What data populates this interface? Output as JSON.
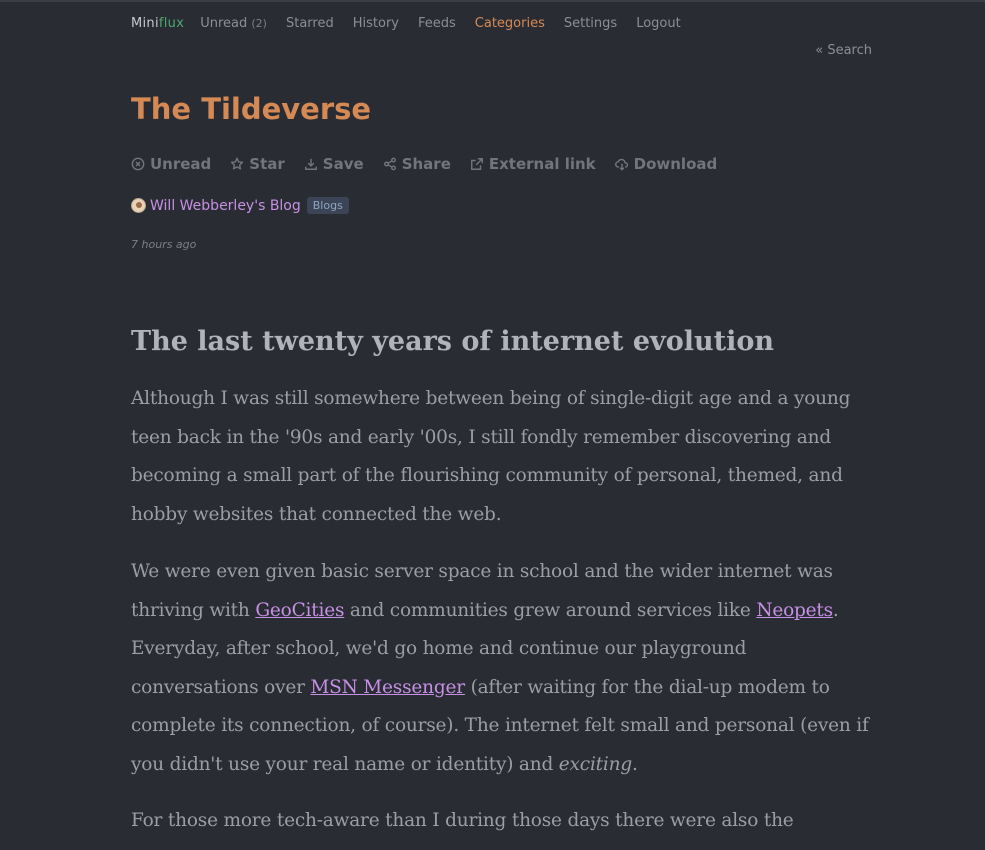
{
  "app": {
    "logo_mini": "Mini",
    "logo_flux": "flux"
  },
  "nav": {
    "unread": "Unread",
    "unread_count": "(2)",
    "starred": "Starred",
    "history": "History",
    "feeds": "Feeds",
    "categories": "Categories",
    "settings": "Settings",
    "logout": "Logout"
  },
  "search_link": "« Search",
  "entry": {
    "title": "The Tildeverse",
    "actions": {
      "unread": "Unread",
      "star": "Star",
      "save": "Save",
      "share": "Share",
      "external": "External link",
      "download": "Download"
    },
    "feed_name": "Will Webberley's Blog",
    "category_badge": "Blogs",
    "date": "7 hours ago"
  },
  "article": {
    "heading": "The last twenty years of internet evolution",
    "p1": [
      "Although I was still somewhere between being of single-digit age and a young",
      "teen back in the '90s and early '00s, I still fondly remember discovering and",
      "becoming a small part of the flourishing community of personal, themed, and",
      "hobby websites that connected the web."
    ],
    "p2": {
      "l1": "We were even given basic server space in school and the wider internet was",
      "l2_a": "thriving with ",
      "l2_link1": "GeoCities",
      "l2_b": " and communities grew around services like ",
      "l2_link2": "Neopets",
      "l2_c": ".",
      "l3": "Everyday, after school, we'd go home and continue our playground",
      "l4_a": "conversations over ",
      "l4_link": "MSN Messenger",
      "l4_b": " (after waiting for the dial-up modem to",
      "l5": "complete its connection, of course). The internet felt small and personal (even if",
      "l6_a": "you didn't use your real name or identity) and ",
      "l6_em": "exciting",
      "l6_b": "."
    },
    "p3": "For those more tech-aware than I during those days there were also the"
  },
  "colors": {
    "accent": "#d58a55",
    "link": "#c690e4",
    "background": "#2a2c33",
    "logo_green": "#4aa86c"
  }
}
